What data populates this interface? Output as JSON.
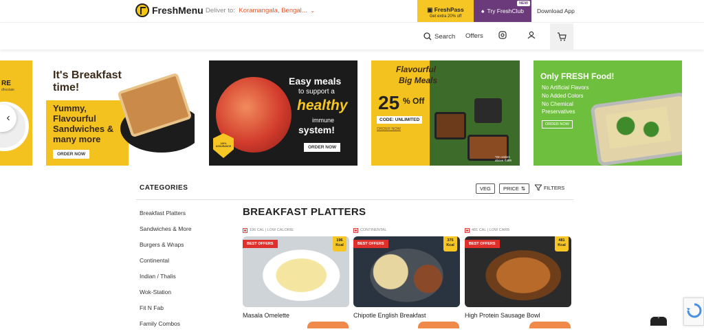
{
  "header": {
    "brand": "FreshMenu",
    "deliver_label": "Deliver to:",
    "location": "Koramangala, Bengal...",
    "freshpass_title": "FreshPass",
    "freshpass_sub": "Get extra 20% off",
    "freshclub_label": "Try FreshClub",
    "new_badge": "NEW",
    "download_label": "Download App"
  },
  "nav": {
    "search": "Search",
    "offers": "Offers"
  },
  "banners": {
    "b0": {
      "line": "RE",
      "sub": "dhoslate"
    },
    "b1": {
      "title": "It's Breakfast time!",
      "body": "Yummy, Flavourful Sandwiches & many more",
      "cta": "ORDER NOW"
    },
    "b2": {
      "line1": "Easy meals",
      "line2": "to support a",
      "line3": "healthy",
      "line4": "immune",
      "line5": "system!",
      "badge": "100% ASSURANCE",
      "cta": "ORDER NOW"
    },
    "b3": {
      "line1": "Flavourful",
      "line2": "Big Meals",
      "pct": "25",
      "off": "% Off",
      "code": "CODE: UNLIMITED",
      "cta": "ORDER NOW",
      "note": "*On orders above ₹499"
    },
    "b4": {
      "title": "Only FRESH Food!",
      "p1": "No Artificial Flavors",
      "p2": "No Added Colors",
      "p3": "No Chemical",
      "p4": "Preservatives",
      "cta": "ORDER NOW"
    }
  },
  "categories": {
    "heading": "CATEGORIES",
    "veg": "VEG",
    "price": "PRICE",
    "filters": "FILTERS",
    "items": [
      "Breakfast Platters",
      "Sandwiches & More",
      "Burgers & Wraps",
      "Continental",
      "Indian / Thalis",
      "Wok-Station",
      "Fit N Fab",
      "Family Combos"
    ]
  },
  "section": {
    "title": "BREAKFAST PLATTERS",
    "cards": [
      {
        "tag": "196 CAL | LOW CALORIE",
        "badge": "BEST OFFERS",
        "kcal_num": "196",
        "kcal_unit": "Kcal",
        "name": "Masala Omelette"
      },
      {
        "tag": "CONTINENTAL",
        "badge": "BEST OFFERS",
        "kcal_num": "375",
        "kcal_unit": "Kcal",
        "name": "Chipotle English Breakfast"
      },
      {
        "tag": "481 CAL | LOW CARB",
        "badge": "BEST OFFERS",
        "kcal_num": "481",
        "kcal_unit": "Kcal",
        "name": "High Protein Sausage Bowl"
      }
    ]
  },
  "colors": {
    "accent": "#f6c624",
    "club": "#6a3a7a",
    "location": "#e0572b",
    "best_offer": "#e0302b"
  }
}
